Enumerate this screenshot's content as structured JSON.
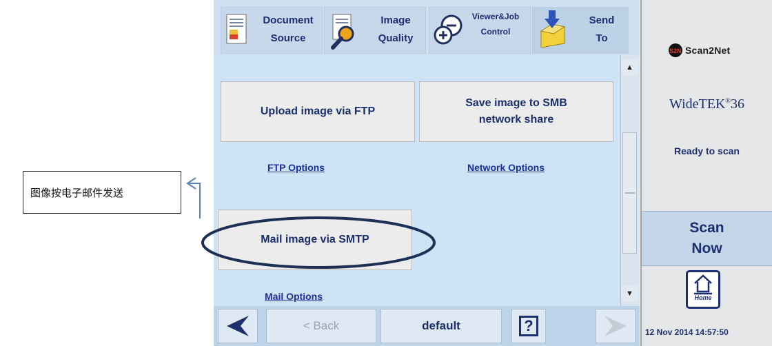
{
  "annotation": {
    "text": "图像按电子邮件发送"
  },
  "toolbar": {
    "tabs": [
      {
        "line1": "Document",
        "line2": "Source",
        "icon": "document-source-icon"
      },
      {
        "line1": "Image",
        "line2": "Quality",
        "icon": "image-quality-icon"
      },
      {
        "line1": "Viewer&Job",
        "line2": "Control",
        "icon": "viewer-job-control-icon"
      },
      {
        "line1": "Send",
        "line2": "To",
        "icon": "send-to-icon"
      }
    ]
  },
  "content": {
    "ftp_button_label": "Upload image via FTP",
    "smb_button_line1": "Save image to SMB",
    "smb_button_line2": "network share",
    "ftp_options_link": "FTP Options",
    "network_options_link": "Network Options",
    "smtp_button_label": "Mail image via SMTP",
    "mail_options_link": "Mail Options"
  },
  "bottom_bar": {
    "back_label": "< Back",
    "profile_label": "default",
    "help_label": "?"
  },
  "right_panel": {
    "logo_text": "Scan2Net",
    "model_name": "WideTEK",
    "model_number": "36",
    "status": "Ready to scan",
    "scan_now_line1": "Scan",
    "scan_now_line2": "Now",
    "home_label": "Home",
    "datetime": "12 Nov 2014 14:57:50"
  },
  "colors": {
    "accent_text": "#1b2f6e",
    "panel_background": "#cfe3f7",
    "highlight_ellipse": "#1d2f55"
  }
}
